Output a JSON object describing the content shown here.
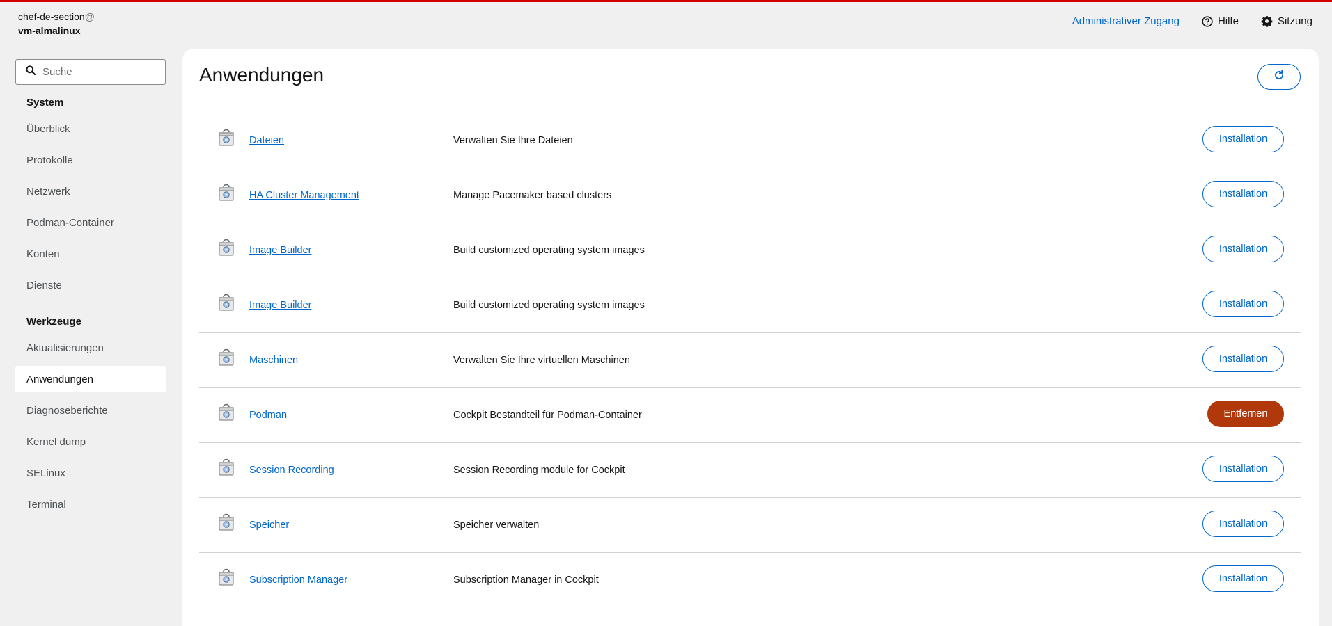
{
  "host": {
    "user": "chef-de-section",
    "at": "@",
    "machine": "vm-almalinux"
  },
  "topnav": {
    "admin": "Administrativer Zugang",
    "help": "Hilfe",
    "session": "Sitzung"
  },
  "sidebar": {
    "search_placeholder": "Suche",
    "sections": [
      {
        "title": "System",
        "items": [
          "Überblick",
          "Protokolle",
          "Netzwerk",
          "Podman-Container",
          "Konten",
          "Dienste"
        ]
      },
      {
        "title": "Werkzeuge",
        "items": [
          "Aktualisierungen",
          "Anwendungen",
          "Diagnoseberichte",
          "Kernel dump",
          "SELinux",
          "Terminal"
        ]
      }
    ],
    "active": "Anwendungen"
  },
  "main": {
    "title": "Anwendungen",
    "rows": [
      {
        "name": "Dateien",
        "desc": "Verwalten Sie Ihre Dateien",
        "action": "Installation",
        "kind": "install"
      },
      {
        "name": "HA Cluster Management",
        "desc": "Manage Pacemaker based clusters",
        "action": "Installation",
        "kind": "install"
      },
      {
        "name": "Image Builder",
        "desc": "Build customized operating system images",
        "action": "Installation",
        "kind": "install"
      },
      {
        "name": "Image Builder",
        "desc": "Build customized operating system images",
        "action": "Installation",
        "kind": "install"
      },
      {
        "name": "Maschinen",
        "desc": "Verwalten Sie Ihre virtuellen Maschinen",
        "action": "Installation",
        "kind": "install"
      },
      {
        "name": "Podman",
        "desc": "Cockpit Bestandteil für Podman-Container",
        "action": "Entfernen",
        "kind": "remove"
      },
      {
        "name": "Session Recording",
        "desc": "Session Recording module for Cockpit",
        "action": "Installation",
        "kind": "install"
      },
      {
        "name": "Speicher",
        "desc": "Speicher verwalten",
        "action": "Installation",
        "kind": "install"
      },
      {
        "name": "Subscription Manager",
        "desc": "Subscription Manager in Cockpit",
        "action": "Installation",
        "kind": "install"
      }
    ]
  },
  "colors": {
    "accent": "#0066cc",
    "danger": "#b1380b",
    "topline": "#d40000"
  },
  "icons": {
    "search": "search-icon",
    "help": "help-icon",
    "session": "gear-icon",
    "refresh": "refresh-icon",
    "package": "package-icon"
  }
}
